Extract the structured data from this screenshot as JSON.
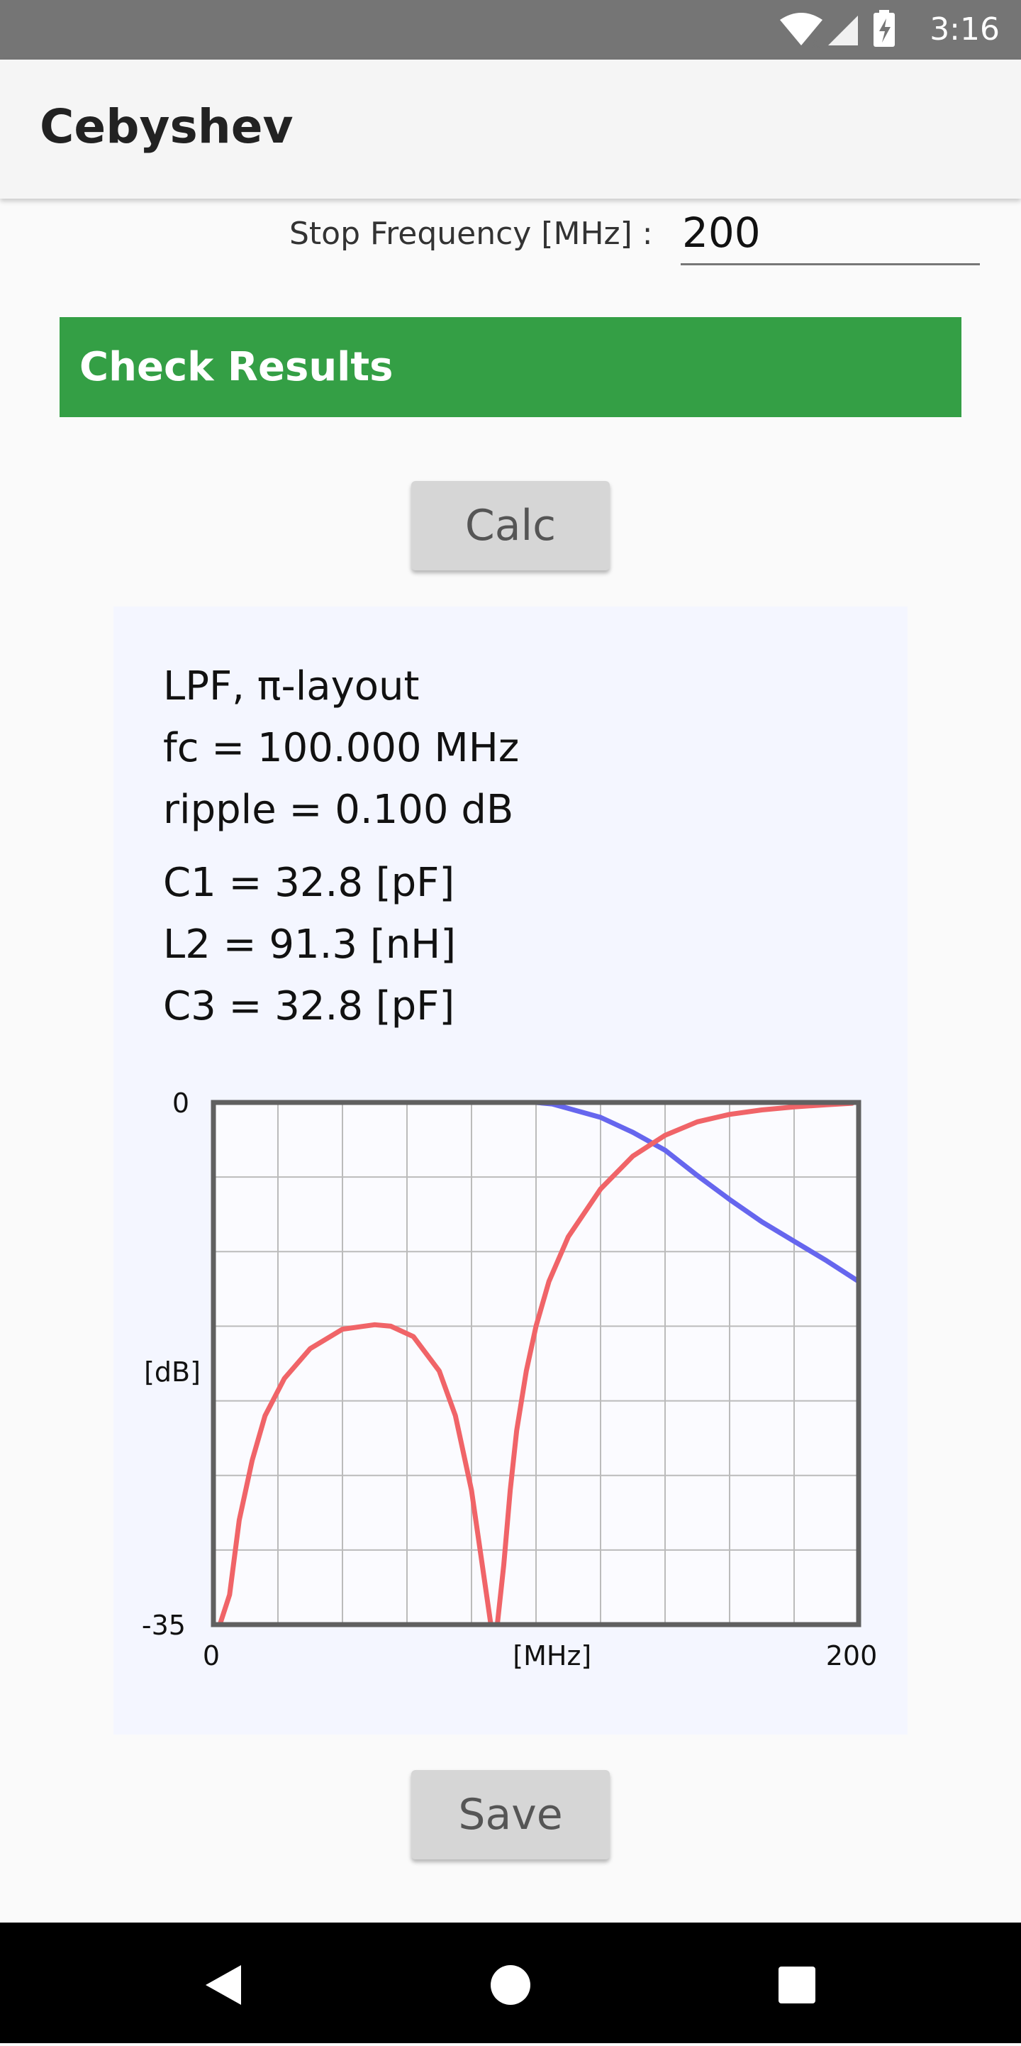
{
  "status_bar": {
    "time": "3:16"
  },
  "app_bar": {
    "title": "Cebyshev"
  },
  "form": {
    "stop_frequency_label": "Stop Frequency [MHz] :",
    "stop_frequency_value": "200"
  },
  "check_results_label": "Check Results",
  "calc_label": "Calc",
  "save_label": "Save",
  "results": {
    "lines": [
      "LPF, π-layout",
      "fc = 100.000 MHz",
      "ripple = 0.100 dB",
      "C1 = 32.8 [pF]",
      "L2 = 91.3 [nH]",
      "C3 = 32.8 [pF]"
    ]
  },
  "chart_data": {
    "type": "line",
    "xlabel": "[MHz]",
    "ylabel": "[dB]",
    "xlim": [
      0,
      200
    ],
    "ylim": [
      -35,
      0
    ],
    "x_tick_labels": [
      "0",
      "200"
    ],
    "y_tick_labels": [
      "0",
      "-35"
    ],
    "grid": true,
    "series": [
      {
        "color": "#6666ee",
        "x": [
          0,
          20,
          40,
          60,
          80,
          100,
          105,
          110,
          120,
          130,
          140,
          150,
          160,
          170,
          180,
          190,
          200
        ],
        "values": [
          0,
          0,
          0,
          0,
          0,
          0,
          -0.1,
          -0.4,
          -1.0,
          -2.0,
          -3.2,
          -4.9,
          -6.5,
          -8.0,
          -9.3,
          -10.6,
          -12.0
        ]
      },
      {
        "color": "#f06468",
        "x": [
          2,
          5,
          8,
          12,
          16,
          22,
          30,
          40,
          50,
          55,
          62,
          70,
          75,
          80,
          84,
          86,
          88,
          90,
          92,
          94,
          97,
          100,
          104,
          110,
          120,
          130,
          140,
          150,
          160,
          170,
          180,
          190,
          198
        ],
        "values": [
          -35,
          -33,
          -28,
          -24,
          -21,
          -18.5,
          -16.5,
          -15.2,
          -14.9,
          -15,
          -15.7,
          -18,
          -21,
          -26,
          -32,
          -35,
          -35,
          -31,
          -26,
          -22,
          -18,
          -15,
          -12,
          -9,
          -5.8,
          -3.6,
          -2.2,
          -1.3,
          -0.8,
          -0.5,
          -0.3,
          -0.15,
          -0.05
        ]
      }
    ]
  }
}
